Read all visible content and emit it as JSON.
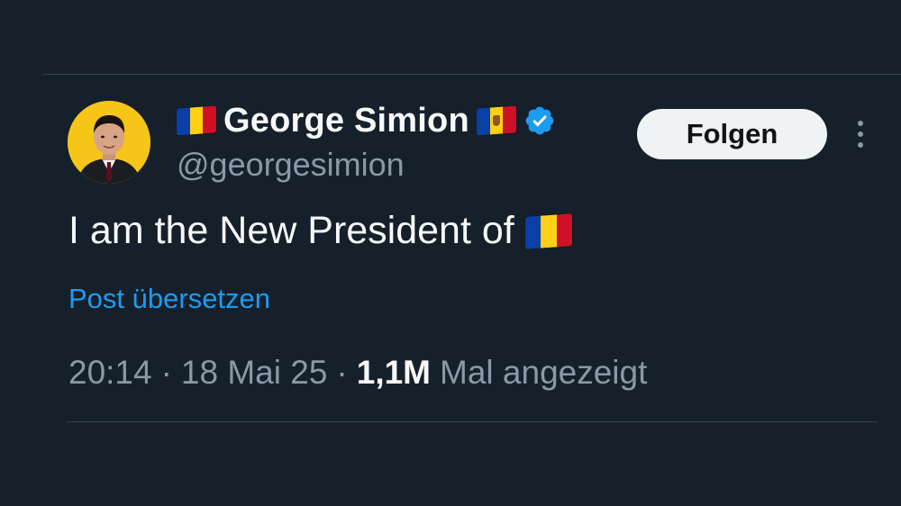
{
  "author": {
    "display_name": "George Simion",
    "handle": "@georgesimion",
    "verified": true,
    "avatar_bg": "#f5c518"
  },
  "follow_button": {
    "label": "Folgen"
  },
  "more_menu": {
    "icon": "more-vertical-icon"
  },
  "post": {
    "text": "I am the New President of",
    "trailing_emoji": "romania-flag-icon",
    "translate_label": "Post übersetzen"
  },
  "meta": {
    "time": "20:14",
    "separator": "·",
    "date": "18 Mai 25",
    "views_count": "1,1M",
    "views_label": "Mal angezeigt"
  },
  "colors": {
    "background": "#15202b",
    "text_primary": "#f7f9f9",
    "text_secondary": "#8b98a5",
    "link": "#1d9bf0",
    "verified": "#1d9bf0",
    "divider": "#38444d",
    "button_bg": "#eff3f4"
  }
}
